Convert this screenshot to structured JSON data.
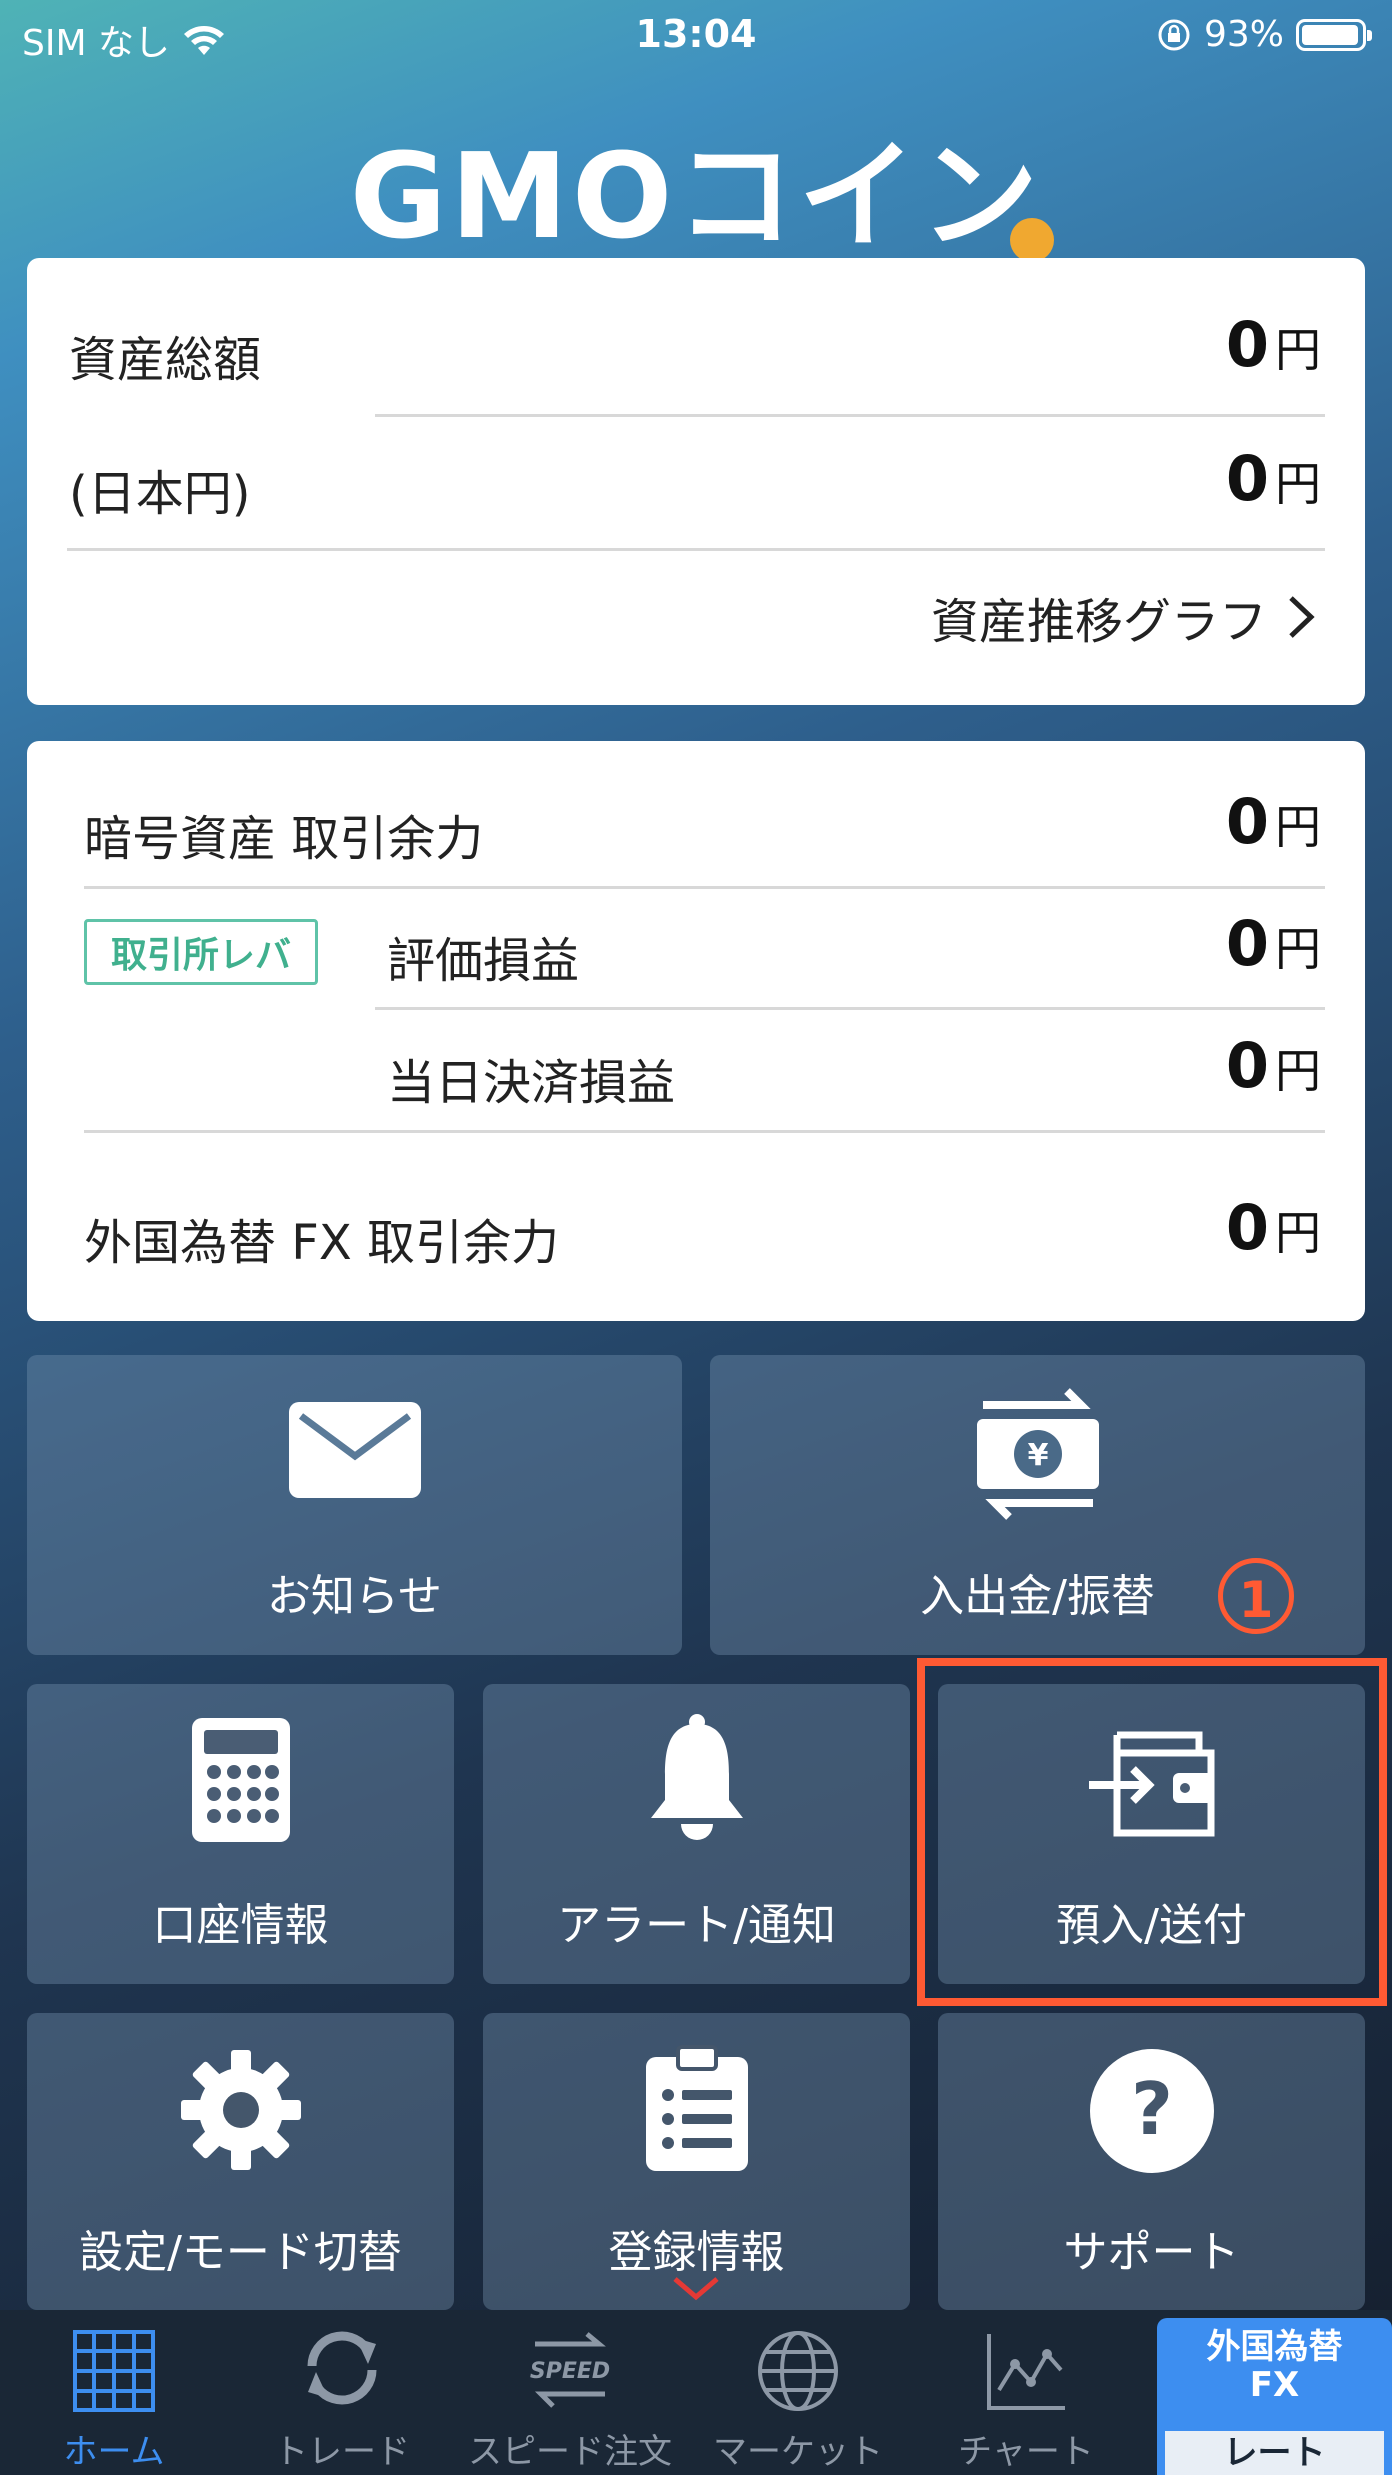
{
  "status_bar": {
    "carrier": "SIM なし",
    "time": "13:04",
    "battery": "93%"
  },
  "logo": {
    "text": "GMOコイン"
  },
  "assets": {
    "total_label": "資産総額",
    "total_value": "0",
    "jpy_label": "(日本円)",
    "jpy_value": "0",
    "unit": "円",
    "graph_link": "資産推移グラフ"
  },
  "margin": {
    "crypto_label": "暗号資産 取引余力",
    "crypto_value": "0",
    "badge": "取引所レバ",
    "valuation_label": "評価損益",
    "valuation_value": "0",
    "daily_label": "当日決済損益",
    "daily_value": "0",
    "fx_label": "外国為替 FX 取引余力",
    "fx_value": "0",
    "unit": "円"
  },
  "tiles": {
    "notice": "お知らせ",
    "deposit": "入出金/振替",
    "account": "口座情報",
    "alert": "アラート/通知",
    "transfer": "預入/送付",
    "settings": "設定/モード切替",
    "registration": "登録情報",
    "support": "サポート"
  },
  "annotation": {
    "step": "1"
  },
  "tabbar": {
    "home": "ホーム",
    "trade": "トレード",
    "speed": "スピード注文",
    "speed_icon_text": "SPEED",
    "market": "マーケット",
    "chart": "チャート",
    "fx_line1": "外国為替",
    "fx_line2": "FX",
    "fx_rate": "レート"
  },
  "colors": {
    "accent": "#3d8ef0",
    "highlight": "#ff5a33",
    "badge": "#5fc3a8"
  }
}
